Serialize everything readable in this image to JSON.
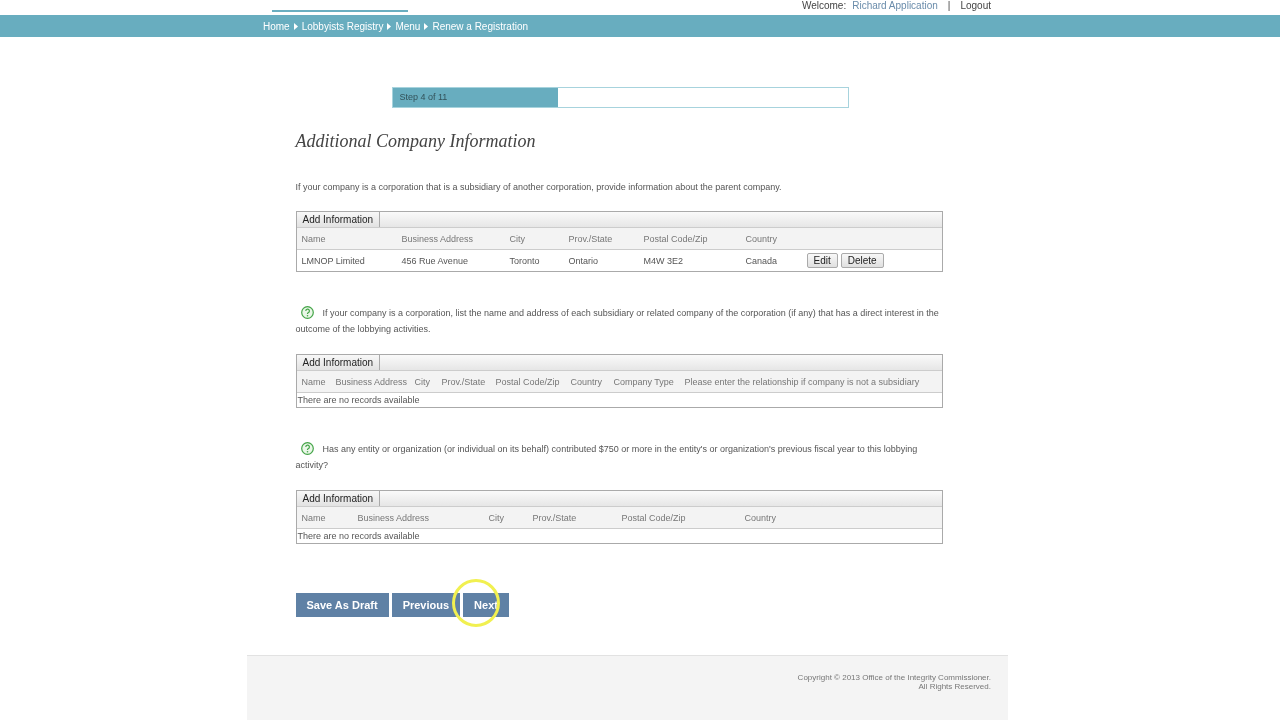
{
  "header": {
    "welcome_label": "Welcome:",
    "user_name": "Richard Application",
    "separator": "|",
    "logout": "Logout"
  },
  "breadcrumb": [
    "Home",
    "Lobbyists Registry",
    "Menu",
    "Renew a Registration"
  ],
  "progress": {
    "label": "Step 4 of 11",
    "level": 0.364
  },
  "title": "Additional Company Information",
  "sections": [
    {
      "help": false,
      "intro": "If your company is a corporation that is a subsidiary of another corporation, provide information about the parent company.",
      "add_button": "Add Information",
      "columns": [
        "Name",
        "Business Address",
        "City",
        "Prov./State",
        "Postal Code/Zip",
        "Country"
      ],
      "rows": [
        {
          "cells": [
            "LMNOP Limited",
            "456 Rue Avenue",
            "Toronto",
            "Ontario",
            "M4W 3E2",
            "Canada"
          ],
          "actions": [
            "Edit",
            "Delete"
          ]
        }
      ]
    },
    {
      "help": true,
      "intro": "If your company is a corporation, list the name and address of each subsidiary or related company of the corporation (if any) that has a direct interest in the outcome of the lobbying activities.",
      "add_button": "Add Information",
      "columns": [
        "Name",
        "Business Address",
        "City",
        "Prov./State",
        "Postal Code/Zip",
        "Country",
        "Company Type",
        "Please enter the relationship if company is not a subsidiary"
      ],
      "empty_text": "There are no records available"
    },
    {
      "help": true,
      "intro": "Has any entity or organization (or individual on its behalf) contributed $750 or more in the entity's or organization's previous fiscal year to this lobbying activity?",
      "add_button": "Add Information",
      "columns": [
        "Name",
        "Business Address",
        "City",
        "Prov./State",
        "Postal Code/Zip",
        "Country"
      ],
      "empty_text": "There are no records available"
    }
  ],
  "buttons": [
    "Save As Draft",
    "Previous",
    "Next"
  ],
  "footer": {
    "copyright": "Copyright © 2013 Office of the Integrity Commissioner.",
    "rights": "All Rights Reserved."
  }
}
